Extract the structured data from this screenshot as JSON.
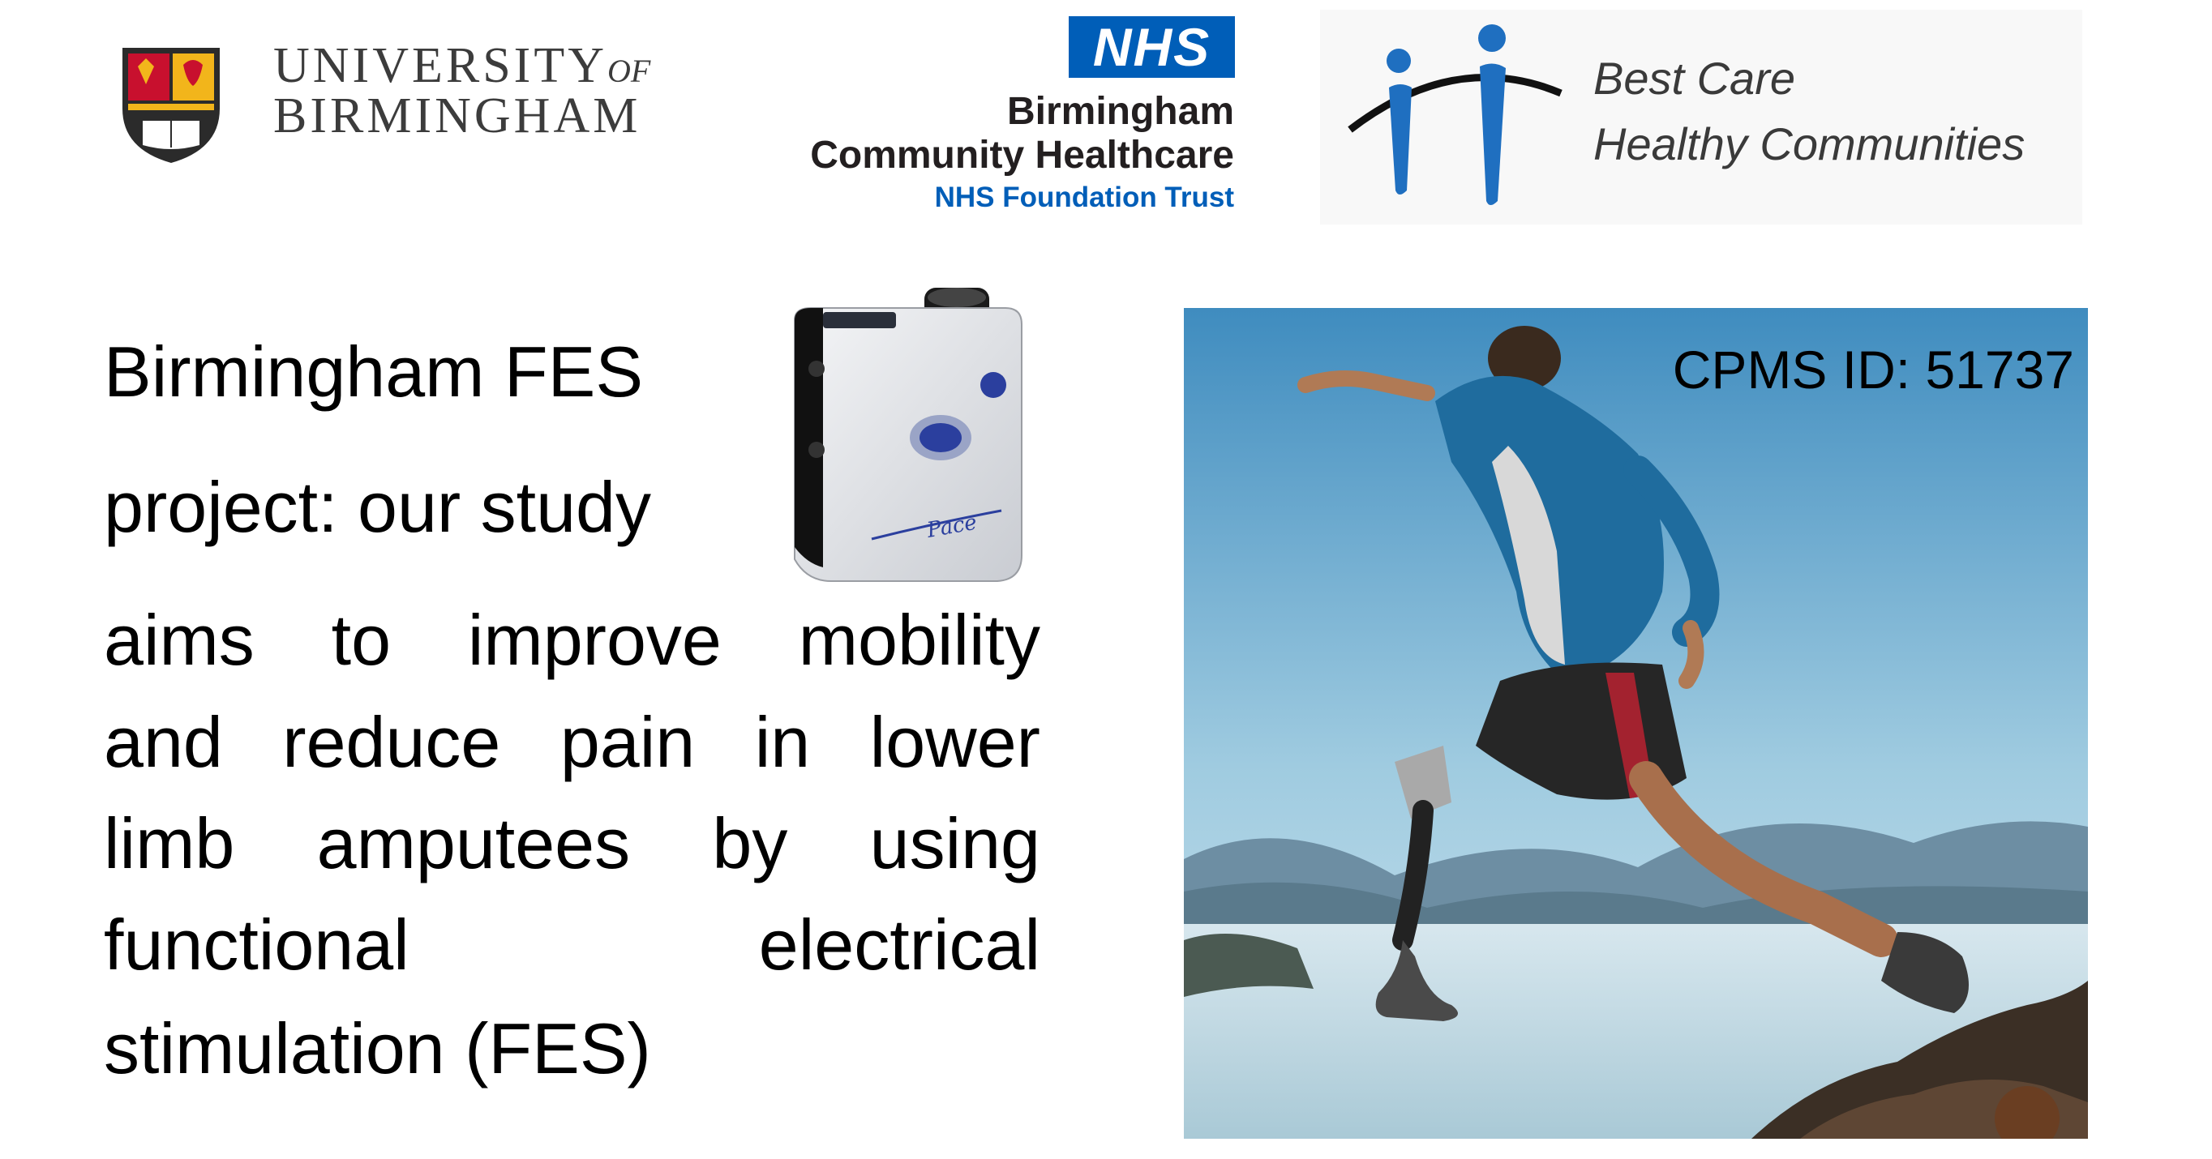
{
  "logos": {
    "university": {
      "line1_main": "UNIVERSITY",
      "line1_of": "OF",
      "line2": "BIRMINGHAM",
      "crest_icon": "university-crest-icon"
    },
    "nhs": {
      "badge": "NHS",
      "line1": "Birmingham",
      "line2": "Community Healthcare",
      "line3": "NHS Foundation Trust",
      "color": "#005eb8"
    },
    "best_care": {
      "line1": "Best Care",
      "line2": "Healthy Communities",
      "figures_icon": "two-people-icon",
      "accent_color": "#1f6fc0"
    }
  },
  "main_text": {
    "line1": "Birmingham FES",
    "line2": "project: our study",
    "line3_words": [
      "aims",
      "to",
      "improve",
      "mobility"
    ],
    "line4_words": [
      "and",
      "reduce",
      "pain",
      "in",
      "lower"
    ],
    "line5_words": [
      "limb",
      "amputees",
      "by",
      "using"
    ],
    "line6_words": [
      "functional",
      "electrical"
    ],
    "line7": "stimulation (FES)"
  },
  "device": {
    "icon": "fes-stimulator-device-icon",
    "brand_text": "Pace"
  },
  "photo": {
    "icon": "amputee-runner-photo",
    "cpms_label": "CPMS ID: 51737"
  }
}
